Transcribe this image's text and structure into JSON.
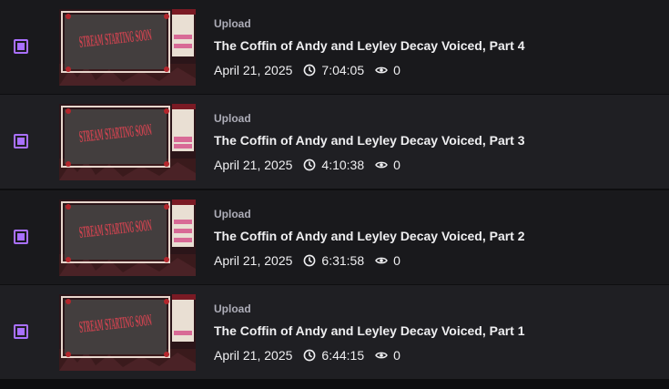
{
  "videos": [
    {
      "type": "Upload",
      "title": "The Coffin of Andy and Leyley Decay Voiced, Part 4",
      "date": "April 21, 2025",
      "duration": "7:04:05",
      "views": "0",
      "thumbnail_text": "STREAM STARTING SOON",
      "selected": true
    },
    {
      "type": "Upload",
      "title": "The Coffin of Andy and Leyley Decay Voiced, Part 3",
      "date": "April 21, 2025",
      "duration": "4:10:38",
      "views": "0",
      "thumbnail_text": "STREAM STARTING SOON",
      "selected": true
    },
    {
      "type": "Upload",
      "title": "The Coffin of Andy and Leyley Decay Voiced, Part 2",
      "date": "April 21, 2025",
      "duration": "6:31:58",
      "views": "0",
      "thumbnail_text": "STREAM STARTING SOON",
      "selected": true
    },
    {
      "type": "Upload",
      "title": "The Coffin of Andy and Leyley Decay Voiced, Part 1",
      "date": "April 21, 2025",
      "duration": "6:44:15",
      "views": "0",
      "thumbnail_text": "STREAM STARTING SOON",
      "selected": true
    }
  ],
  "icons": {
    "checkbox": "checkbox-checked-icon",
    "duration": "clock-icon",
    "views": "eye-icon"
  },
  "colors": {
    "accent": "#a970ff",
    "row_dark": "#19191c",
    "row_light": "#1f1f23",
    "text_primary": "#efeff1",
    "text_secondary": "#adadb8"
  }
}
